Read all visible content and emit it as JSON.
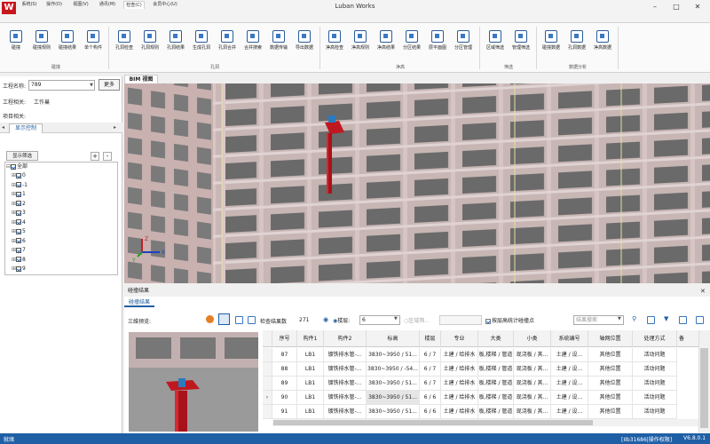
{
  "app": {
    "title": "Luban Works",
    "logo_letter": "W"
  },
  "window_controls": [
    "–",
    "□",
    "✕"
  ],
  "menu": {
    "items": [
      "系统(S)",
      "操作(O)",
      "视图(V)",
      "通讯(M)",
      "检查(C)",
      "会员中心(U)"
    ],
    "active_index": 4
  },
  "ribbon": {
    "buttons": [
      "碰撞",
      "碰撞规则",
      "碰撞结果",
      "单个构件",
      "孔洞检查",
      "孔洞规则",
      "孔洞结果",
      "生成孔洞",
      "孔洞合并",
      "合并搜索",
      "数据传输",
      "导出数据",
      "净高检查",
      "净高规则",
      "净高结果",
      "分区结果",
      "层平面图",
      "分区管理",
      "区域筛选",
      "管理筛选",
      "碰撞数据",
      "孔洞数据",
      "净高数据"
    ],
    "groups": [
      "碰撞",
      "孔洞",
      "净高",
      "筛选",
      "数据分析"
    ]
  },
  "left": {
    "project_label": "工程名称:",
    "project_value": "789",
    "more_button": "更多",
    "related_person_label": "工程相关:",
    "related_person_value": "工作巢",
    "project_related_label": "项目相关:",
    "tab_display": "显示控制",
    "filter_button": "显示筛选",
    "add_btn": "+",
    "remove_btn": "-",
    "tree": [
      {
        "label": "全部",
        "level": 0
      },
      {
        "label": "0",
        "level": 1
      },
      {
        "label": "-1",
        "level": 1
      },
      {
        "label": "1",
        "level": 1
      },
      {
        "label": "2",
        "level": 1
      },
      {
        "label": "3",
        "level": 1
      },
      {
        "label": "4",
        "level": 1
      },
      {
        "label": "5",
        "level": 1
      },
      {
        "label": "6",
        "level": 1
      },
      {
        "label": "7",
        "level": 1
      },
      {
        "label": "8",
        "level": 1
      },
      {
        "label": "9",
        "level": 1
      }
    ]
  },
  "bim": {
    "tab": "BIM 视图",
    "axes": {
      "z": "Z",
      "x": "X",
      "y": "Y"
    }
  },
  "result": {
    "header": "碰撞结果",
    "tab": "碰撞结果",
    "preview_label": "三维预览:",
    "count_label": "检查结果数",
    "count_value": "271",
    "floor_radio": "楼层:",
    "floor_value": "6",
    "zone_radio": "区域筛...",
    "height_checkbox": "按层高统计碰撞点",
    "search_placeholder": "结果搜索",
    "columns": [
      "序号",
      "构件1",
      "构件2",
      "标高",
      "楼层",
      "专业",
      "大类",
      "小类",
      "系统编号",
      "轴网位置",
      "处理方式",
      "备"
    ],
    "rows": [
      [
        "87",
        "LB1",
        "镀铁排水管-...",
        "3830~3950 / 51...",
        "6 / 7",
        "土建 / 给排水",
        "板,楼梯 / 管道",
        "现浇板 / 其...",
        "土建 / 设...",
        "其他位置",
        "活动问题"
      ],
      [
        "88",
        "LB1",
        "镀铁排水管-...",
        "3830~3950 / -54...",
        "6 / 7",
        "土建 / 给排水",
        "板,楼梯 / 管道",
        "现浇板 / 其...",
        "土建 / 设...",
        "其他位置",
        "活动问题"
      ],
      [
        "89",
        "LB1",
        "镀铁排水管-...",
        "3830~3950 / 51...",
        "6 / 7",
        "土建 / 给排水",
        "板,楼梯 / 管道",
        "现浇板 / 其...",
        "土建 / 设...",
        "其他位置",
        "活动问题"
      ],
      [
        "90",
        "LB1",
        "镀铁排水管-...",
        "3830~3950 / 51...",
        "6 / 6",
        "土建 / 给排水",
        "板,楼梯 / 管道",
        "现浇板 / 其...",
        "土建 / 设...",
        "其他位置",
        "活动问题"
      ],
      [
        "91",
        "LB1",
        "镀铁排水管-...",
        "3830~3950 / 51...",
        "6 / 6",
        "土建 / 给排水",
        "板,楼梯 / 管道",
        "现浇板 / 其...",
        "土建 / 设...",
        "其他位置",
        "活动问题"
      ]
    ],
    "selected_row_index": 3,
    "selected_row_marker": "›"
  },
  "status": {
    "left": "就绪",
    "right": "[IIb31686|操作权限]",
    "version": "V6.8.0.1"
  },
  "colors": {
    "accent": "#1f5fa6",
    "pipe": "#b8141c",
    "status": "#1f5fa6"
  }
}
